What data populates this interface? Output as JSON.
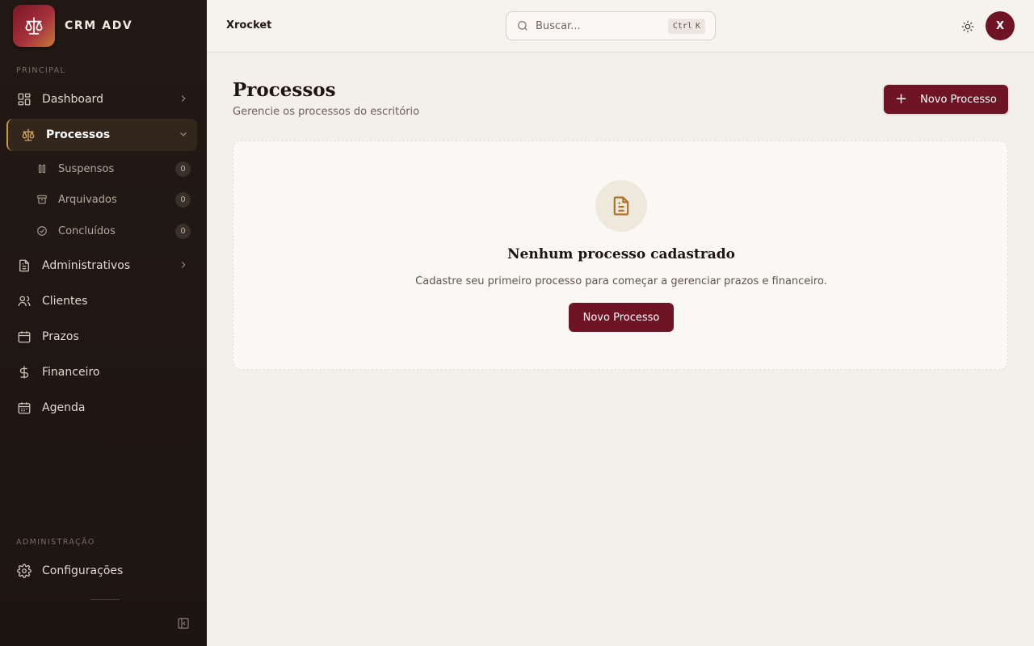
{
  "brand": {
    "name": "CRM ADV",
    "logo_icon": "scale-icon"
  },
  "sidebar": {
    "section_principal": "PRINCIPAL",
    "section_admin": "ADMINISTRAÇÃO",
    "items": [
      {
        "label": "Dashboard",
        "icon": "dashboard-icon"
      },
      {
        "label": "Processos",
        "icon": "scale-icon",
        "active": true
      },
      {
        "label": "Administrativos",
        "icon": "document-icon"
      },
      {
        "label": "Clientes",
        "icon": "users-icon"
      },
      {
        "label": "Prazos",
        "icon": "calendar-icon"
      },
      {
        "label": "Financeiro",
        "icon": "dollar-icon"
      },
      {
        "label": "Agenda",
        "icon": "calendar-grid-icon"
      }
    ],
    "sub_items": [
      {
        "label": "Suspensos",
        "count": "0",
        "icon": "pause-icon"
      },
      {
        "label": "Arquivados",
        "count": "0",
        "icon": "archive-icon"
      },
      {
        "label": "Concluídos",
        "count": "0",
        "icon": "check-circle-icon"
      }
    ],
    "settings_label": "Configurações"
  },
  "header": {
    "workspace": "Xrocket",
    "search_placeholder": "Buscar...",
    "shortcut_ctrl": "Ctrl",
    "shortcut_key": "K",
    "avatar_initial": "X"
  },
  "main": {
    "title": "Processos",
    "subtitle": "Gerencie os processos do escritório",
    "new_button": "Novo Processo",
    "empty": {
      "title": "Nenhum processo cadastrado",
      "description": "Cadastre seu primeiro processo para começar a gerenciar prazos e financeiro.",
      "button": "Novo Processo"
    }
  },
  "colors": {
    "sidebar_bg": "#1f1713",
    "accent": "#6e1424",
    "gold": "#c79a4e",
    "page_bg": "#f3efea"
  }
}
